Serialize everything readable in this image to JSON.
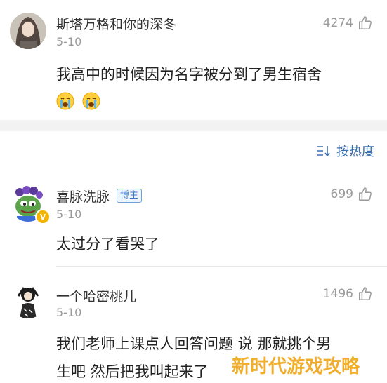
{
  "comments": [
    {
      "username": "斯塔万格和你的深冬",
      "date": "5-10",
      "likes": "4274",
      "text": "我高中的时候因为名字被分到了男生宿舍",
      "emojis": [
        "crying-face",
        "crying-face"
      ]
    },
    {
      "username": "喜脉洗脉",
      "badge": "博主",
      "date": "5-10",
      "likes": "699",
      "text": "太过分了看哭了"
    },
    {
      "username": "一个哈密桃儿",
      "date": "5-10",
      "likes": "1496",
      "text_line1": "我们老师上课点人回答问题 说 那就挑个男",
      "text_line2": "生吧 然后把我叫起来了"
    }
  ],
  "sort": {
    "label": "按热度",
    "icon": "sort-icon"
  },
  "watermark": "新时代游戏攻略",
  "colors": {
    "accent": "#3a6fb0",
    "muted": "#9a9a9a",
    "watermark": "#f0a81c"
  }
}
